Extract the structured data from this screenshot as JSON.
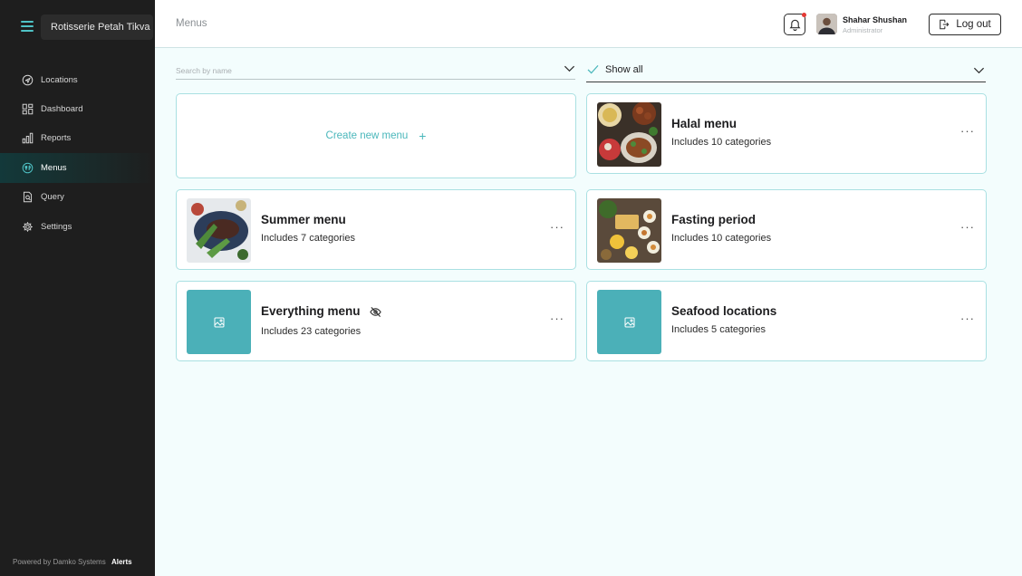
{
  "sidebar": {
    "location": "Rotisserie Petah Tikva",
    "items": [
      {
        "label": "Locations",
        "icon": "location-icon"
      },
      {
        "label": "Dashboard",
        "icon": "dashboard-icon"
      },
      {
        "label": "Reports",
        "icon": "reports-icon"
      },
      {
        "label": "Menus",
        "icon": "menus-icon",
        "active": true
      },
      {
        "label": "Query",
        "icon": "query-icon"
      },
      {
        "label": "Settings",
        "icon": "settings-icon"
      }
    ],
    "footer": {
      "powered_by": "Powered by Damko Systems",
      "alerts": "Alerts"
    }
  },
  "header": {
    "title": "Menus",
    "user": {
      "name": "Shahar Shushan",
      "role": "Administrator"
    },
    "logout_label": "Log out"
  },
  "filters": {
    "search_placeholder": "Search by name",
    "show_label": "Show all"
  },
  "create_card": {
    "label": "Create new menu",
    "plus": "+"
  },
  "menus": [
    {
      "title": "Halal menu",
      "subtitle": "Includes 10 categories"
    },
    {
      "title": "Summer menu",
      "subtitle": "Includes 7 categories"
    },
    {
      "title": "Fasting period",
      "subtitle": "Includes 10 categories"
    },
    {
      "title": "Everything menu",
      "subtitle": "Includes 23 categories",
      "hidden": true
    },
    {
      "title": "Seafood locations",
      "subtitle": "Includes 5 categories"
    }
  ],
  "more_label": "···",
  "colors": {
    "accent": "#4ab7bb",
    "sidebar_bg": "#1e1e1e",
    "page_bg": "#f3fdfd",
    "card_border": "#a9e0e2",
    "placeholder_tile": "#4bb0b8",
    "notification_dot": "#e53935"
  }
}
